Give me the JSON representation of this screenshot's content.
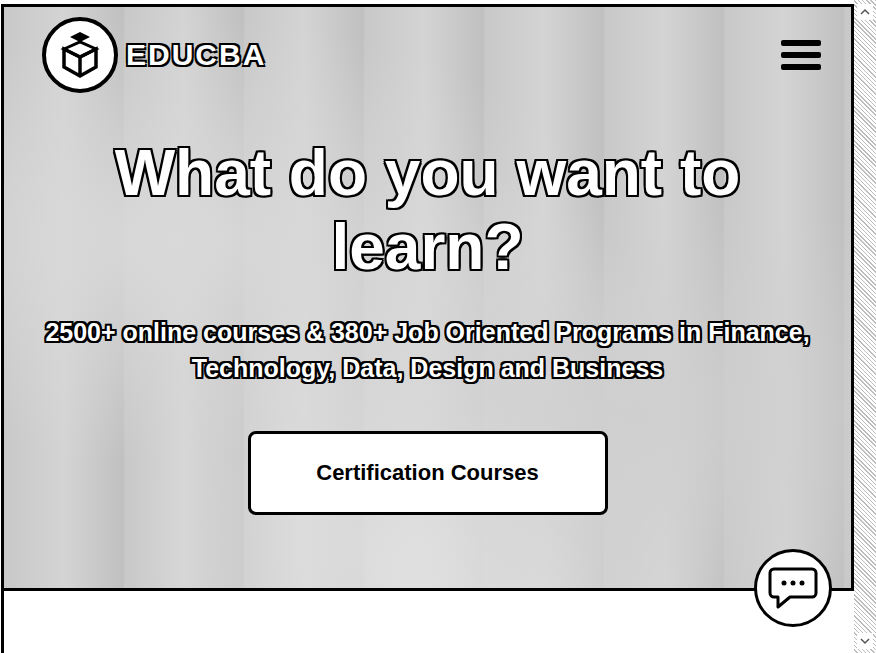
{
  "brand": {
    "name": "EDUCBA"
  },
  "hero": {
    "title": "What do you want to learn?",
    "subtitle": "2500+ online courses & 380+ Job Oriented Programs in Finance, Technology, Data, Design and Business",
    "button": "Certification Courses"
  }
}
